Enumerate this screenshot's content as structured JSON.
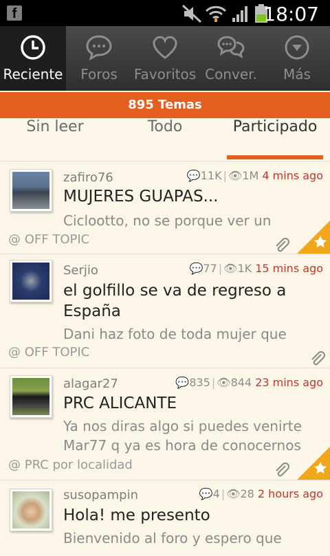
{
  "statusbar": {
    "time": "18:07",
    "icons": [
      "facebook-icon",
      "mute-icon",
      "wifi-icon",
      "signal-icon",
      "battery-icon"
    ]
  },
  "nav": {
    "tabs": [
      {
        "label": "Reciente",
        "icon": "clock-icon",
        "active": true
      },
      {
        "label": "Foros",
        "icon": "speech-bubble-icon"
      },
      {
        "label": "Favoritos",
        "icon": "heart-icon"
      },
      {
        "label": "Conver.",
        "icon": "conversations-icon"
      },
      {
        "label": "Más",
        "icon": "chevron-down-circle-icon"
      }
    ]
  },
  "topics_count": "895 Temas",
  "subtabs": [
    {
      "label": "Sin leer"
    },
    {
      "label": "Todo"
    },
    {
      "label": "Participado",
      "active": true
    }
  ],
  "threads": [
    {
      "user": "zafiro76",
      "replies": "11K",
      "views": "1M",
      "time": "4 mins ago",
      "title": "MUJERES GUAPAS...",
      "preview": "Ciclootto, no se porque ver un",
      "forum": "@ OFF TOPIC",
      "attachment": true,
      "starred": true
    },
    {
      "user": "Serjio",
      "replies": "77",
      "views": "1K",
      "time": "15 mins ago",
      "title": "el golfillo se va de regreso a España",
      "preview": "Dani haz foto de toda mujer que",
      "forum": "@ OFF TOPIC",
      "attachment": true,
      "starred": false
    },
    {
      "user": "alagar27",
      "replies": "835",
      "views": "844",
      "time": "23 mins ago",
      "title": "PRC ALICANTE",
      "preview": "Ya nos diras algo si puedes venirte Mar77 q ya es hora de conocernos",
      "forum": "@ PRC por localidad",
      "attachment": true,
      "starred": true
    },
    {
      "user": "susopampin",
      "replies": "4",
      "views": "28",
      "time": "2 hours ago",
      "title": "Hola! me presento",
      "preview": "Bienvenido al foro y espero que",
      "forum": "",
      "attachment": false,
      "starred": false
    }
  ],
  "colors": {
    "accent": "#e25f20",
    "background": "#fbf6e8",
    "time": "#c0392b"
  }
}
